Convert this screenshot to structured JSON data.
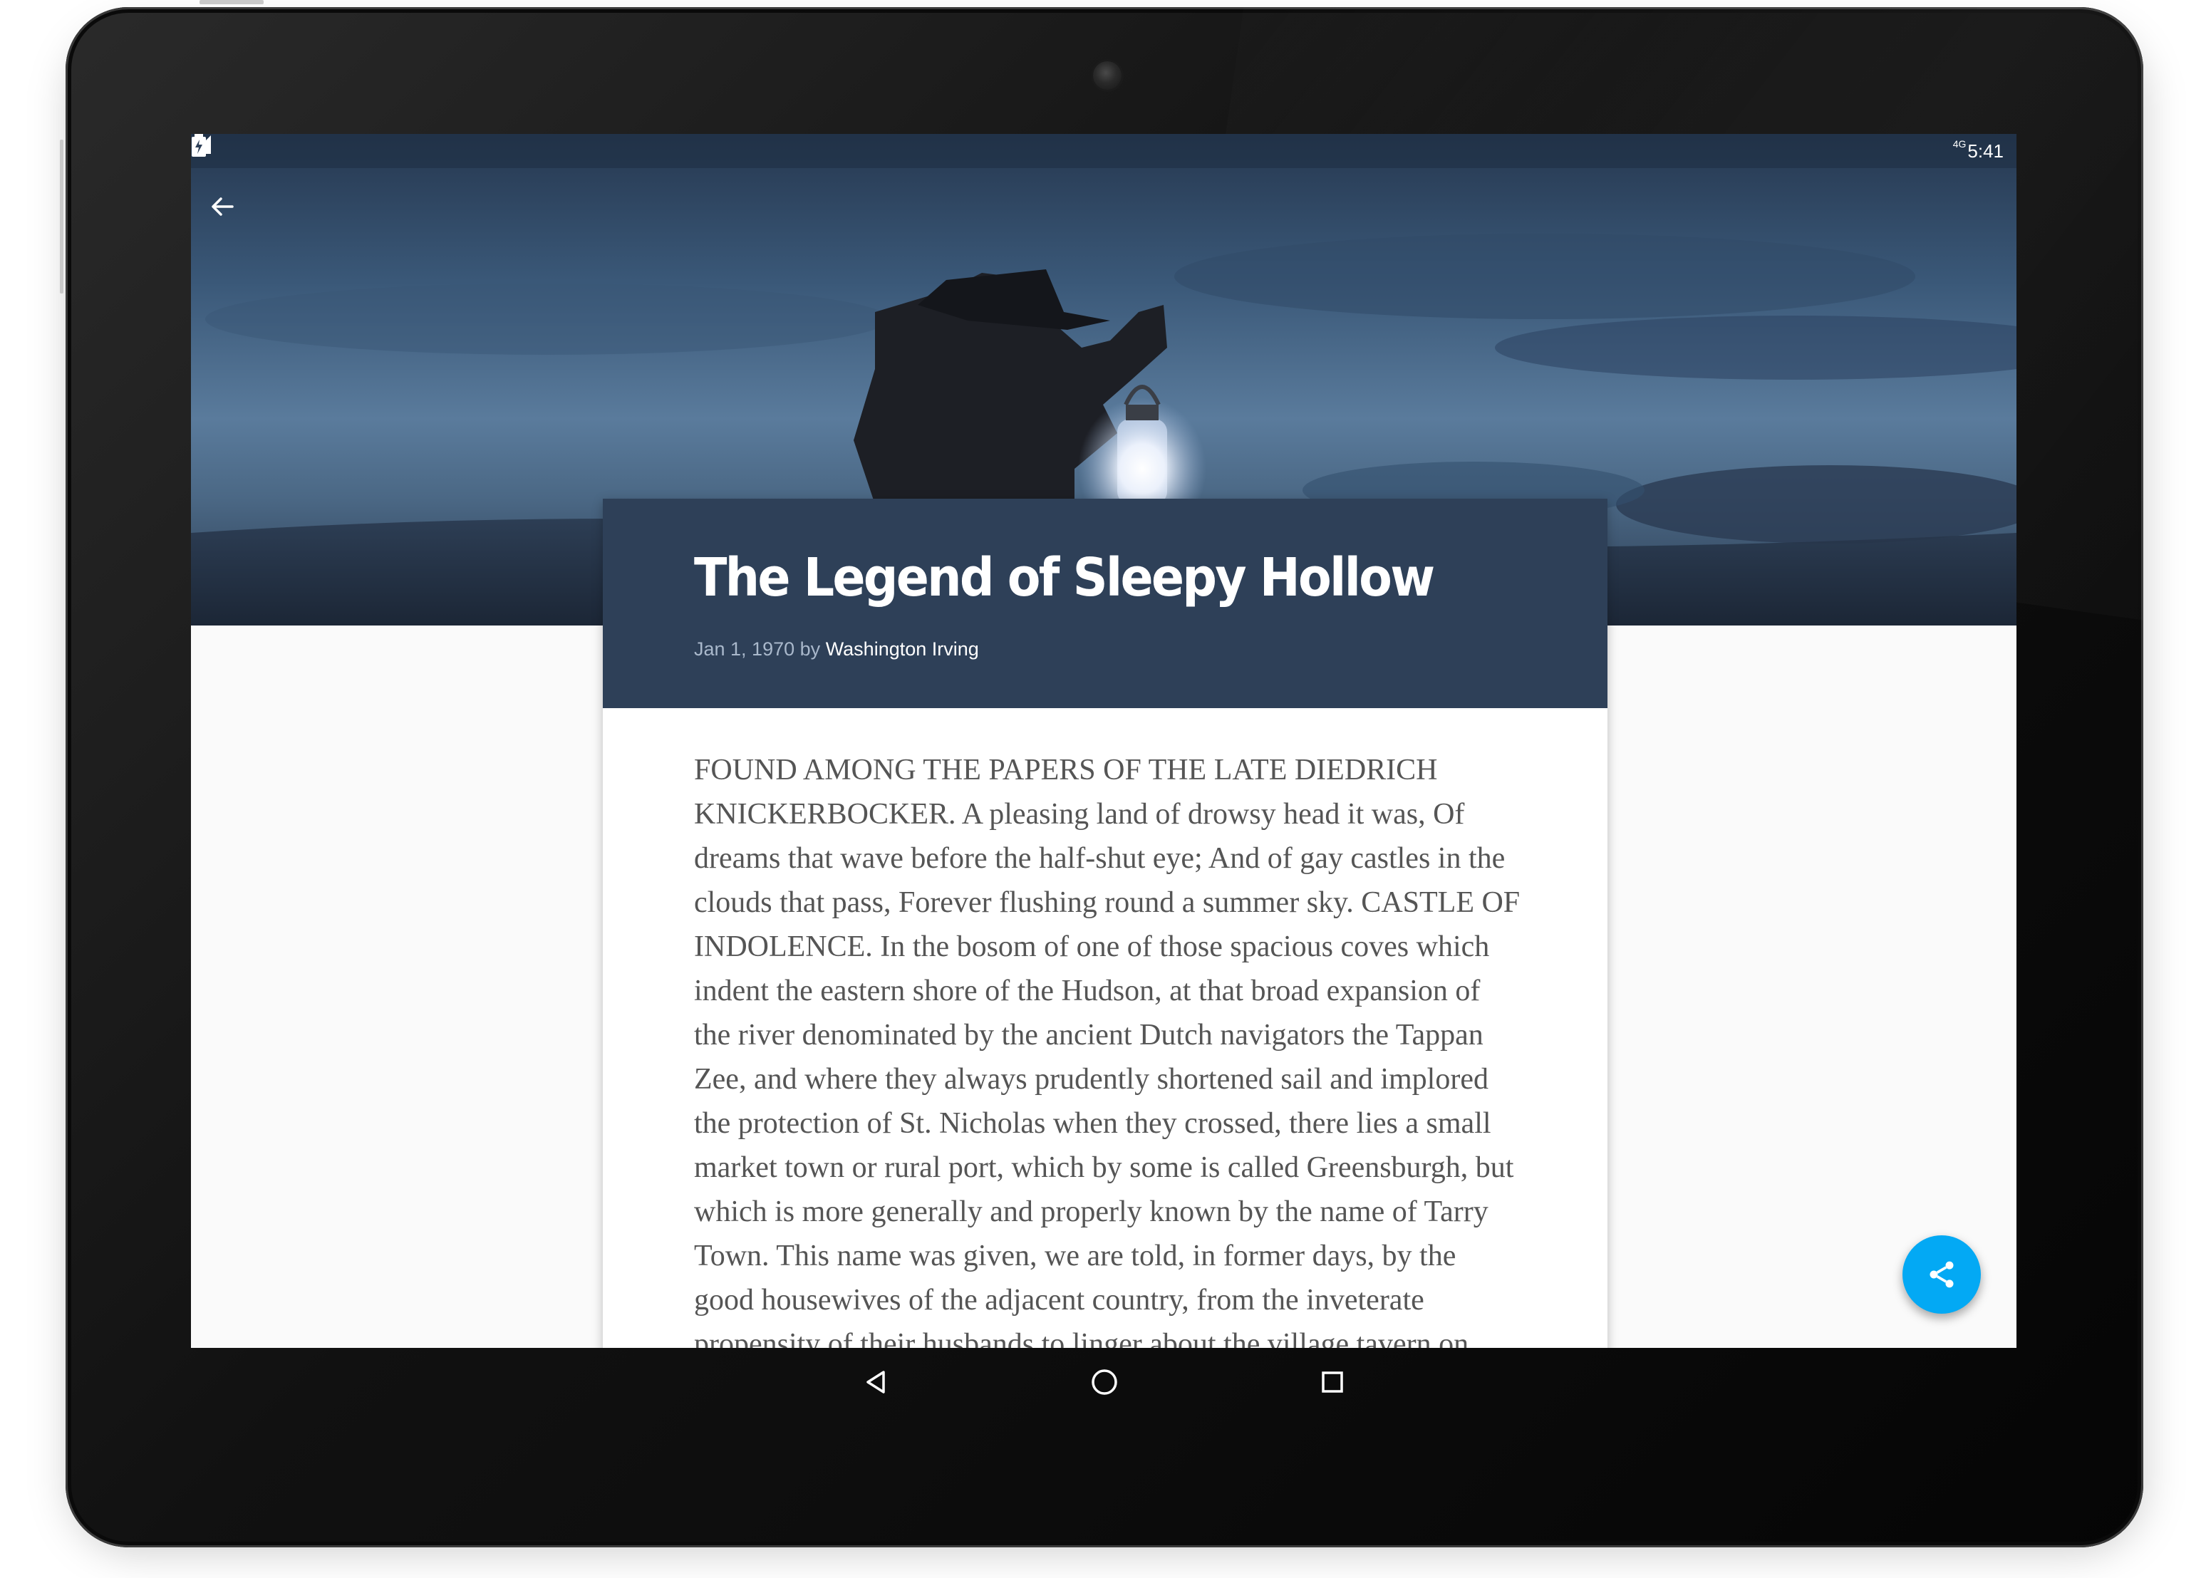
{
  "status_bar": {
    "network": "4G",
    "time": "5:41"
  },
  "toolbar": {
    "back_icon": "arrow-back-icon"
  },
  "article": {
    "title": "The Legend of Sleepy Hollow",
    "date": "Jan 1, 1970",
    "by": "by",
    "author": "Washington Irving",
    "body": "FOUND AMONG THE PAPERS OF THE LATE DIEDRICH KNICKERBOCKER. A pleasing land of drowsy head it was, Of dreams that wave before the half-shut eye; And of gay castles in the clouds that pass, Forever flushing round a summer sky. CASTLE OF INDOLENCE. In the bosom of one of those spacious coves which indent the eastern shore of the Hudson, at that broad expansion of the river denominated by the ancient Dutch navigators the Tappan Zee, and where they always prudently shortened sail and implored the protection of St. Nicholas when they crossed, there lies a small market town or rural port, which by some is called Greensburgh, but which is more generally and properly known by the name of Tarry Town. This name was given, we are told, in former days, by the good housewives of the adjacent country, from the inveterate propensity of their husbands to linger about the village tavern on market days."
  },
  "fab": {
    "icon": "share-icon",
    "color": "#03a9f4"
  },
  "nav_bar": {
    "back": "nav-back-icon",
    "home": "nav-home-icon",
    "recents": "nav-recents-icon"
  },
  "colors": {
    "header": "#2e4058",
    "accent": "#03a9f4"
  }
}
